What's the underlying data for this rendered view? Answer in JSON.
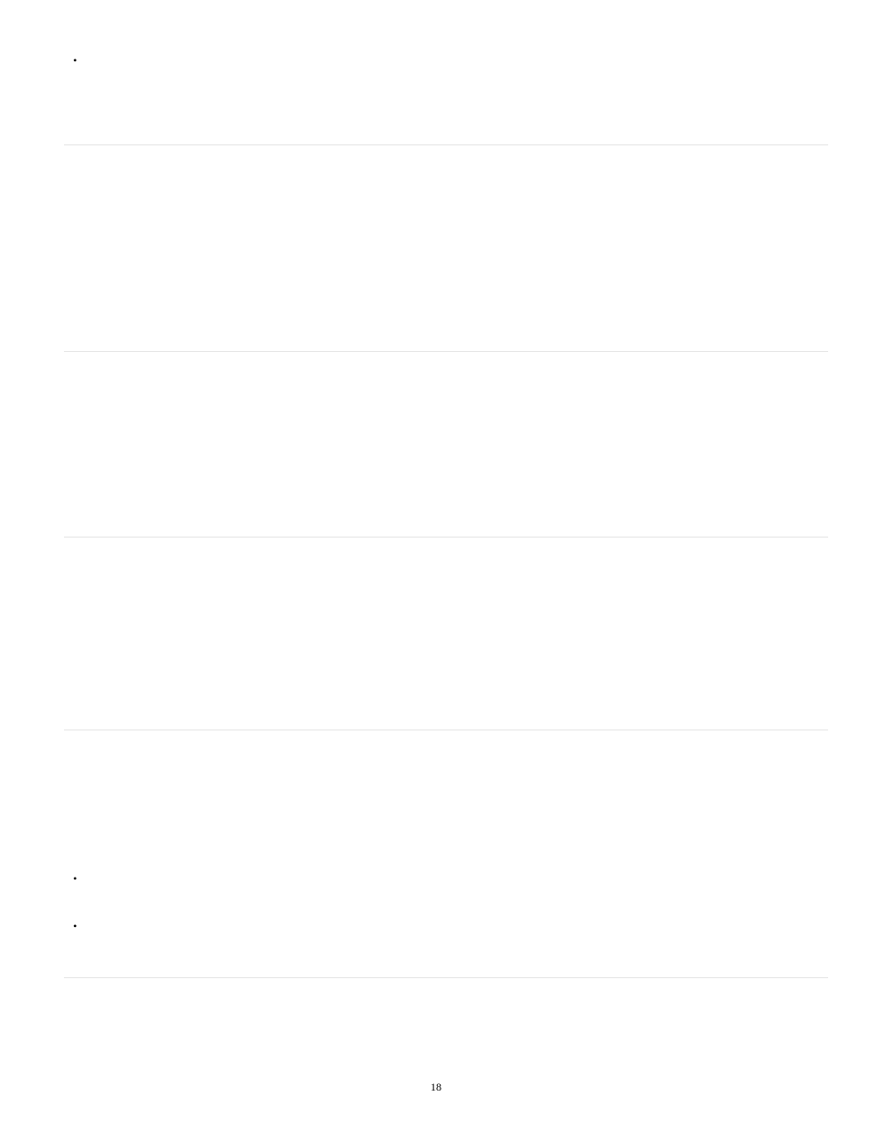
{
  "top_bullets": {
    "items": [
      {
        "text": ""
      }
    ]
  },
  "bottom_bullets": {
    "items": [
      {
        "text": ""
      },
      {
        "text": ""
      }
    ]
  },
  "page_number": "18"
}
